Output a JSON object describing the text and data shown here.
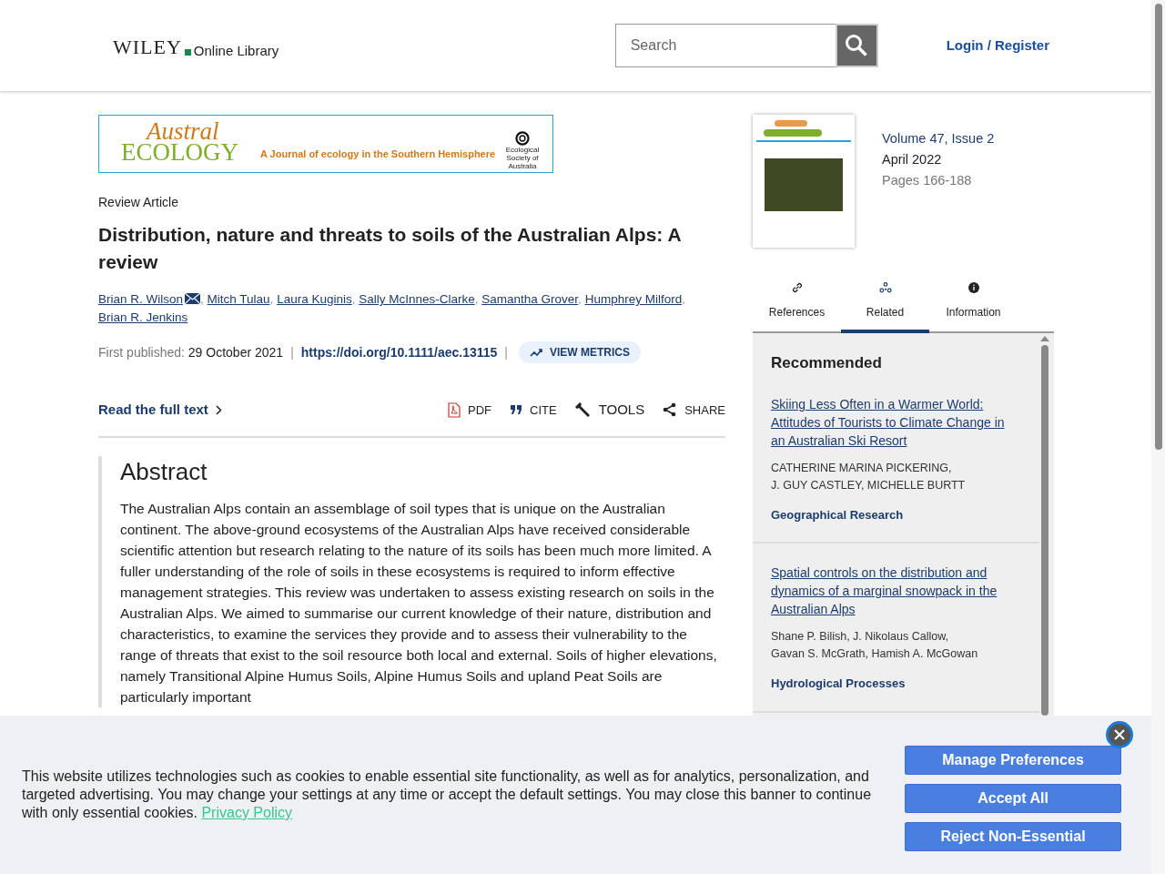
{
  "header": {
    "logo_brand": "WILEY",
    "logo_sub": "Online Library",
    "search": {
      "placeholder": "Search"
    },
    "login": "Login / Register"
  },
  "banner": {
    "title_top": "Austral",
    "title_bottom": "ECOLOGY",
    "tagline": "A Journal of ecology in the Southern Hemisphere",
    "society": "Ecological Society of Australia"
  },
  "article": {
    "type": "Review Article",
    "title": "Distribution, nature and threats to soils of the Australian Alps: A review",
    "authors": [
      {
        "name": "Brian R. Wilson",
        "corresponding": true
      },
      {
        "name": "Mitch Tulau",
        "corresponding": false
      },
      {
        "name": "Laura Kuginis",
        "corresponding": false
      },
      {
        "name": "Sally McInnes-Clarke",
        "corresponding": false
      },
      {
        "name": "Samantha Grover",
        "corresponding": false
      },
      {
        "name": "Humphrey Milford",
        "corresponding": false
      },
      {
        "name": "Brian R. Jenkins",
        "corresponding": false
      }
    ],
    "author_separator": ",",
    "meta_separator": "|",
    "published_label": "First published:",
    "published_date": "29 October 2021",
    "doi": "https://doi.org/10.1111/aec.13115",
    "metrics_button": "VIEW METRICS",
    "read_full_text": "Read the full text",
    "actions": [
      {
        "kind": "pdf",
        "label": "PDF"
      },
      {
        "kind": "cite",
        "label": "CITE"
      },
      {
        "kind": "tools",
        "label": "TOOLS"
      },
      {
        "kind": "share",
        "label": "SHARE"
      }
    ],
    "abstract_heading": "Abstract",
    "abstract": "The Australian Alps contain an assemblage of soil types that is unique on the Australian continent. The above-ground ecosystems of the Australian Alps have received considerable scientific attention but research relating to the nature of its soils has been much more limited. A fuller understanding of the role of soils in these ecosystems is required to inform effective management strategies. This review was undertaken to assess existing research on soils in the Australian Alps. We aimed to summarise our current knowledge of their nature, distribution and characteristics, to examine the services they provide and to assess their vulnerability to the range of threats that exist to the soil resource both local and external. Soils of higher elevations, namely Transitional Alpine Humus Soils, Alpine Humus Soils and upland Peat Soils are particularly important"
  },
  "issue": {
    "volume": "Volume 47, Issue 2",
    "date": "April 2022",
    "pages": "Pages 166-188"
  },
  "tabs": [
    {
      "kind": "references",
      "label": "References",
      "selected": false
    },
    {
      "kind": "related",
      "label": "Related",
      "selected": true
    },
    {
      "kind": "information",
      "label": "Information",
      "selected": false
    }
  ],
  "recommended": {
    "heading": "Recommended",
    "items": [
      {
        "title": "Skiing Less Often in a Warmer World: Attitudes of Tourists to Climate Change in an Australian Ski Resort",
        "author_lines": [
          "CATHERINE MARINA PICKERING,",
          "J. GUY CASTLEY, MICHELLE BURTT"
        ],
        "journal": "Geographical Research"
      },
      {
        "title": "Spatial controls on the distribution and dynamics of a marginal snowpack in the Australian Alps",
        "author_lines": [
          "Shane P. Bilish, J. Nikolaus Callow,",
          "Gavan S. McGrath, Hamish A. McGowan"
        ],
        "journal": "Hydrological Processes"
      }
    ]
  },
  "cookie": {
    "text": "This website utilizes technologies such as cookies to enable essential site functionality, as well as for analytics, personalization, and targeted advertising. You may change your settings at any time or accept the default settings. You may close this banner to continue with only essential cookies.",
    "link": "Privacy Policy",
    "buttons": [
      "Manage Preferences",
      "Accept All",
      "Reject Non-Essential"
    ]
  }
}
